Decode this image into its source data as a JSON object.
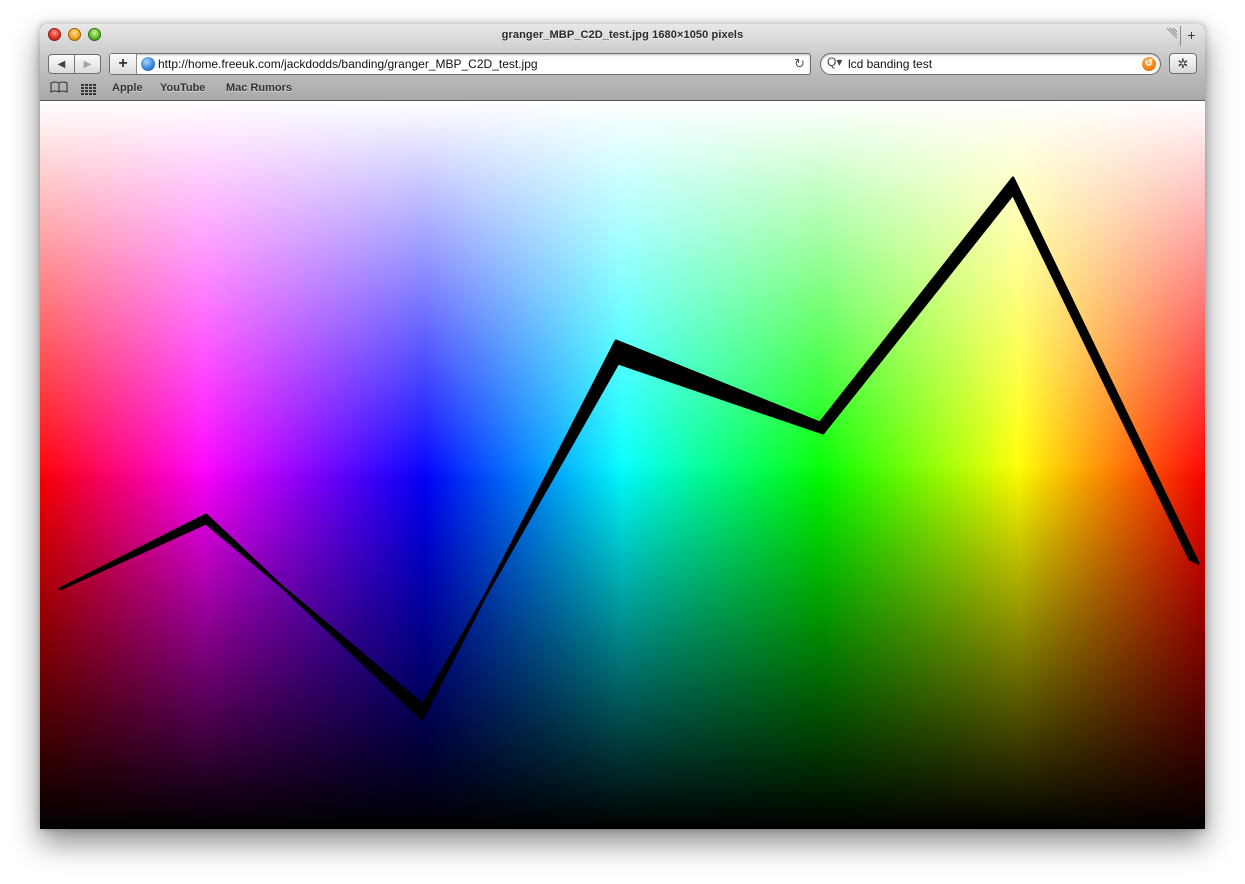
{
  "window": {
    "title": "granger_MBP_C2D_test.jpg 1680×1050 pixels"
  },
  "toolbar": {
    "back_icon": "◀",
    "forward_icon": "▶",
    "add_bookmark_icon": "+",
    "url": "http://home.freeuk.com/jackdodds/banding/granger_MBP_C2D_test.jpg",
    "reload_icon": "↻",
    "search_value": "lcd banding test",
    "search_icon": "Q▾",
    "snapback_icon": "↺",
    "bug_icon": "✲",
    "new_tab_icon": "+"
  },
  "bookmarks": {
    "items": [
      "Apple",
      "YouTube",
      "Mac Rumors"
    ]
  },
  "colors": {
    "stroke": "#000000"
  }
}
